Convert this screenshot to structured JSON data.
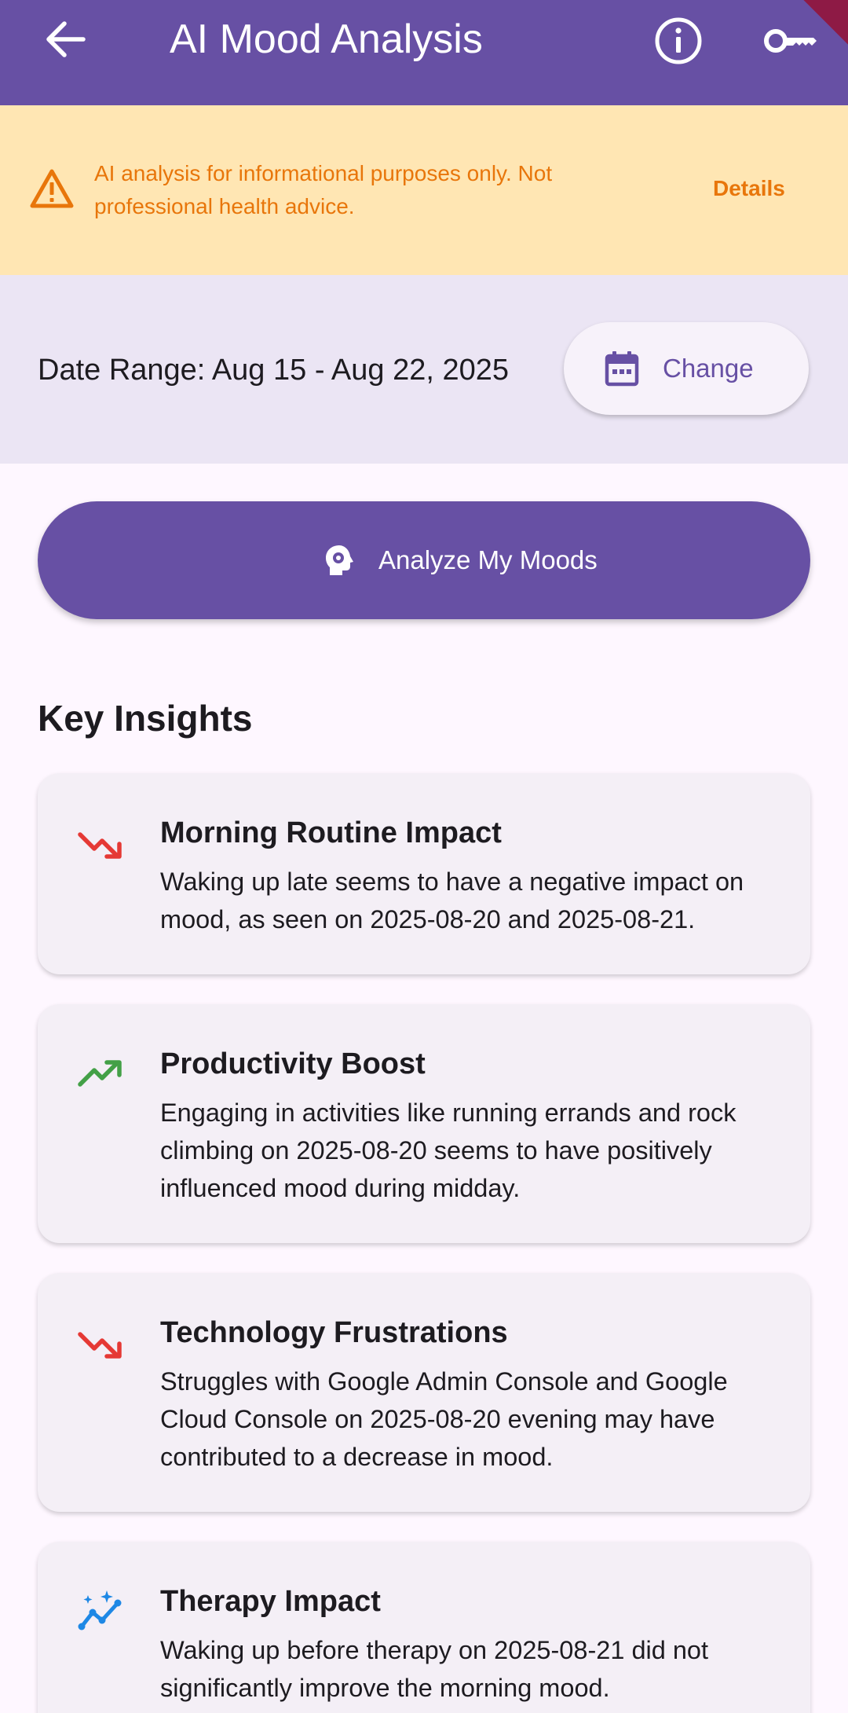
{
  "app_bar": {
    "title": "AI Mood Analysis",
    "back_icon": "arrow-back-icon",
    "info_icon": "info-icon",
    "key_icon": "key-icon",
    "background": "#6750A4"
  },
  "disclaimer": {
    "icon": "warning-icon",
    "text": "AI analysis for informational purposes only. Not professional health advice.",
    "details_label": "Details",
    "color": "#E8760B",
    "background": "#FFE6B3"
  },
  "date_range": {
    "label": "Date Range: Aug 15 - Aug 22, 2025",
    "change_label": "Change",
    "change_icon": "calendar-icon"
  },
  "analyze": {
    "label": "Analyze My Moods",
    "icon": "psychology-icon"
  },
  "insights": {
    "section_title": "Key Insights",
    "items": [
      {
        "icon": "trending-down-icon",
        "title": "Morning Routine Impact",
        "body": "Waking up late seems to have a negative impact on mood, as seen on 2025-08-20 and 2025-08-21."
      },
      {
        "icon": "trending-up-icon",
        "title": "Productivity Boost",
        "body": "Engaging in activities like running errands and rock climbing on 2025-08-20 seems to have positively influenced mood during midday."
      },
      {
        "icon": "trending-down-icon",
        "title": "Technology Frustrations",
        "body": "Struggles with Google Admin Console and Google Cloud Console on 2025-08-20 evening may have contributed to a decrease in mood."
      },
      {
        "icon": "insights-icon",
        "title": "Therapy Impact",
        "body": "Waking up before therapy on 2025-08-21 did not significantly improve the morning mood."
      }
    ]
  },
  "colors": {
    "primary": "#6750A4",
    "negative": "#E53935",
    "positive": "#43A047",
    "neutral": "#1E88E5"
  }
}
